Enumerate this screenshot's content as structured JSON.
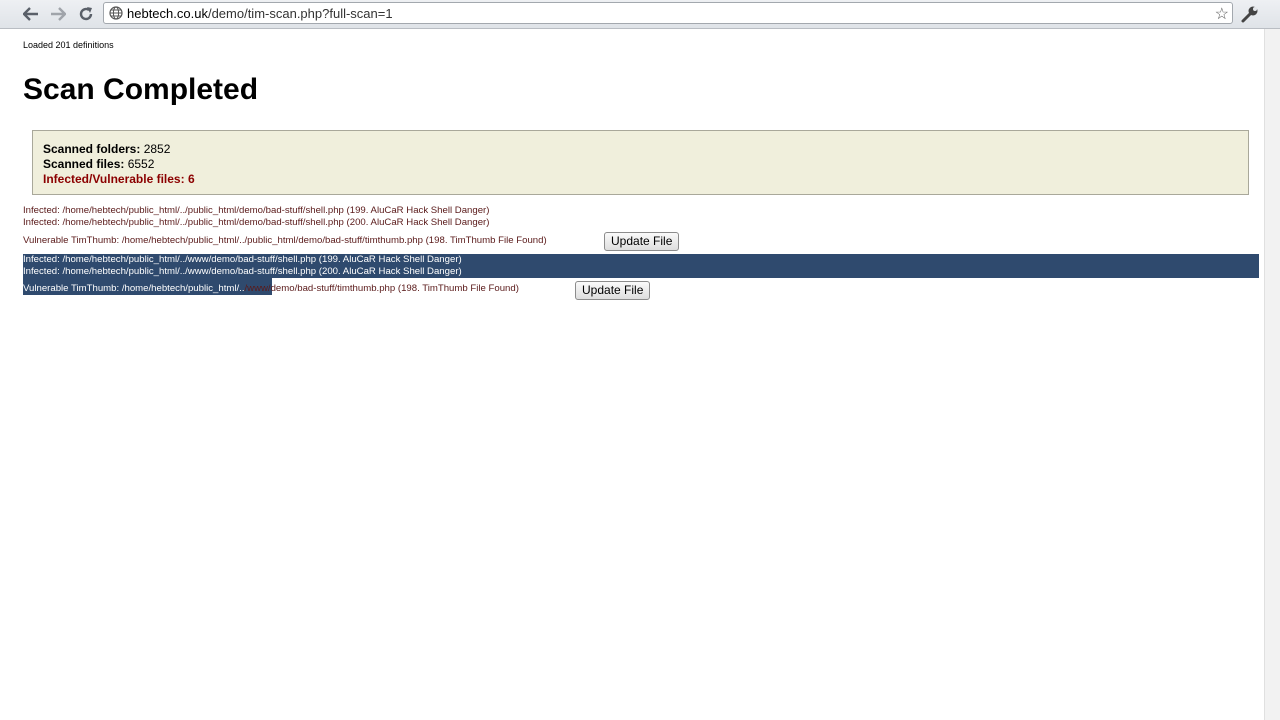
{
  "browser": {
    "url_host": "hebtech.co.uk",
    "url_path": "/demo/tim-scan.php?full-scan=1"
  },
  "page": {
    "loaded_text": "Loaded 201 definitions",
    "title": "Scan Completed",
    "summary": {
      "folders_label": "Scanned folders:",
      "folders_value": "2852",
      "files_label": "Scanned files:",
      "files_value": "6552",
      "infected_label": "Infected/Vulnerable files:",
      "infected_value": "6"
    },
    "results": [
      "Infected: /home/hebtech/public_html/../public_html/demo/bad-stuff/shell.php (199. AluCaR Hack Shell Danger)",
      "Infected: /home/hebtech/public_html/../public_html/demo/bad-stuff/shell.php (200. AluCaR Hack Shell Danger)",
      "Vulnerable TimThumb: /home/hebtech/public_html/../public_html/demo/bad-stuff/timthumb.php (198. TimThumb File Found)",
      "Infected: /home/hebtech/public_html/../www/demo/bad-stuff/shell.php (199. AluCaR Hack Shell Danger)",
      "Infected: /home/hebtech/public_html/../www/demo/bad-stuff/shell.php (200. AluCaR Hack Shell Danger)",
      "Vulnerable TimThumb: /home/hebtech/public_html/../www/demo/bad-stuff/timthumb.php (198. TimThumb File Found)"
    ],
    "update_button_label": "Update File"
  }
}
